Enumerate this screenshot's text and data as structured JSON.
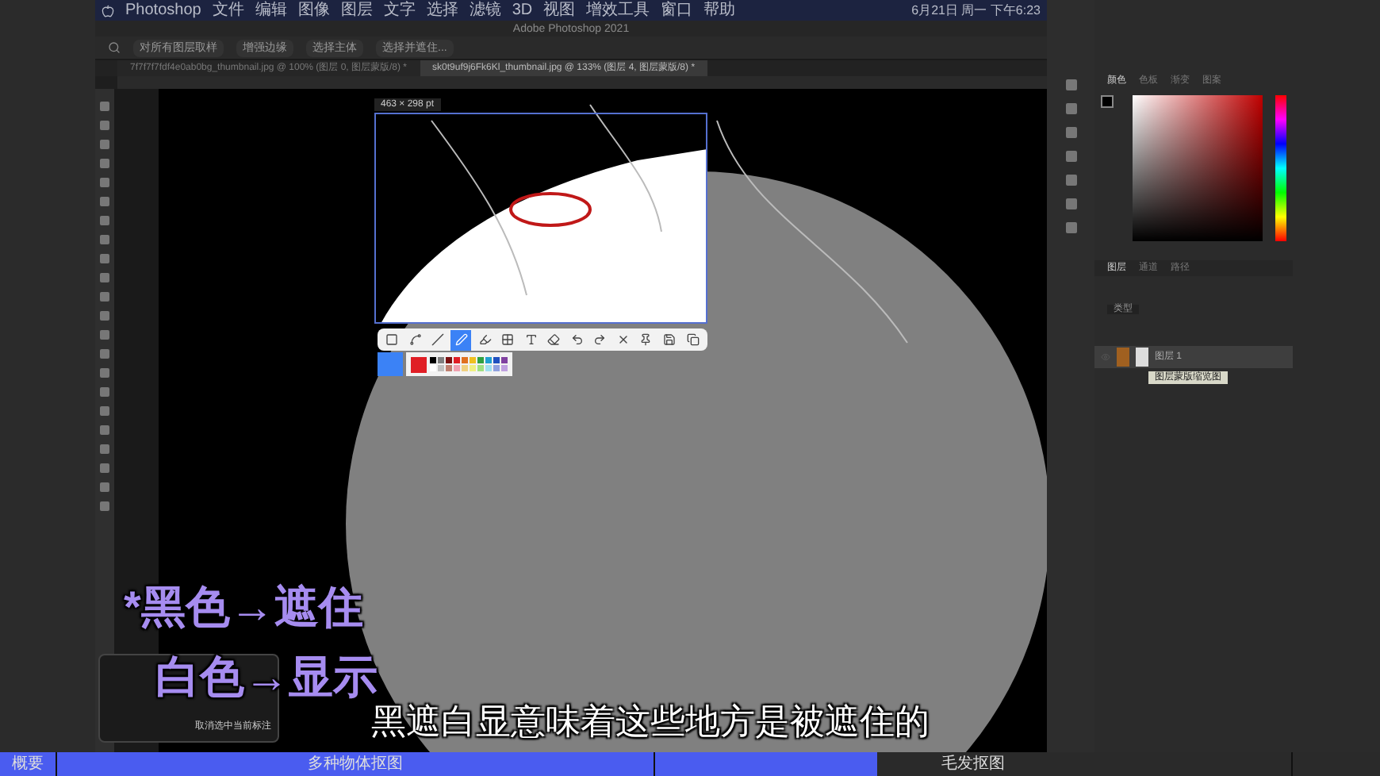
{
  "menu_bar": {
    "items": [
      "Photoshop",
      "文件",
      "编辑",
      "图像",
      "图层",
      "文字",
      "选择",
      "滤镜",
      "3D",
      "视图",
      "增效工具",
      "窗口",
      "帮助"
    ],
    "clock": "6月21日 周一 下午6:23"
  },
  "window": {
    "title": "Adobe Photoshop 2021"
  },
  "options_bar": {
    "buttons": [
      "对所有图层取样",
      "增强边缘",
      "选择主体",
      "选择并遮住..."
    ]
  },
  "document_tabs": [
    {
      "label": "7f7f7f7fdf4e0ab0bg_thumbnail.jpg @ 100% (图层 0, 图层蒙版/8) *",
      "selected": false
    },
    {
      "label": "sk0t9uf9j6Fk6Kl_thumbnail.jpg @ 133% (图层 4, 图层蒙版/8) *",
      "selected": true
    }
  ],
  "selection": {
    "size": "463 × 298 pt"
  },
  "annotation_toolbar": {
    "tools": [
      {
        "kind": "rectangle",
        "selected": false
      },
      {
        "kind": "curve",
        "selected": false
      },
      {
        "kind": "line",
        "selected": false
      },
      {
        "kind": "pen",
        "selected": true
      },
      {
        "kind": "marker",
        "selected": false
      },
      {
        "kind": "mosaic",
        "selected": false
      },
      {
        "kind": "text",
        "selected": false
      },
      {
        "kind": "eraser",
        "selected": false
      },
      {
        "kind": "undo",
        "selected": false
      },
      {
        "kind": "redo",
        "selected": false
      },
      {
        "kind": "close",
        "selected": false
      },
      {
        "kind": "pin",
        "selected": false
      },
      {
        "kind": "save",
        "selected": false
      },
      {
        "kind": "copy",
        "selected": false
      }
    ],
    "active_swatch": {
      "color": "#e01e25"
    },
    "palette": [
      {
        "color": "#000000"
      },
      {
        "color": "#808080"
      },
      {
        "color": "#7a1010"
      },
      {
        "color": "#e01e25"
      },
      {
        "color": "#e07020"
      },
      {
        "color": "#f0c020"
      },
      {
        "color": "#30a040"
      },
      {
        "color": "#20a0d0"
      },
      {
        "color": "#2050c0"
      },
      {
        "color": "#8040a0"
      },
      {
        "color": "#ffffff"
      },
      {
        "color": "#c0c0c0"
      },
      {
        "color": "#c08070"
      },
      {
        "color": "#f0a0b0"
      },
      {
        "color": "#f0d080"
      },
      {
        "color": "#f0f080"
      },
      {
        "color": "#a0e080"
      },
      {
        "color": "#a0e0f0"
      },
      {
        "color": "#90a0e0"
      },
      {
        "color": "#c0a0e0"
      }
    ]
  },
  "panels": {
    "color_tabs": [
      {
        "label": "颜色",
        "selected": true
      },
      {
        "label": "色板",
        "selected": false
      },
      {
        "label": "渐变",
        "selected": false
      },
      {
        "label": "图案",
        "selected": false
      }
    ],
    "layers_tabs": [
      {
        "label": "图层",
        "selected": true
      },
      {
        "label": "通道",
        "selected": false
      },
      {
        "label": "路径",
        "selected": false
      }
    ],
    "layer_filter": "类型",
    "layer": {
      "name": "图层 1",
      "selected": true
    },
    "tooltip": "图层蒙版缩览图"
  },
  "shortcut_popup": {
    "hint": "取消选中当前标注"
  },
  "caption_overlay": [
    "*黑色→遮住",
    "白色→显示"
  ],
  "subtitle": "黑遮白显意味着这些地方是被遮住的",
  "chapter_bar": [
    {
      "label": "概要",
      "level": 1
    },
    {
      "label": "多种物体抠图",
      "level": 1
    },
    {
      "label": "毛发抠图",
      "level": 0.35
    }
  ]
}
